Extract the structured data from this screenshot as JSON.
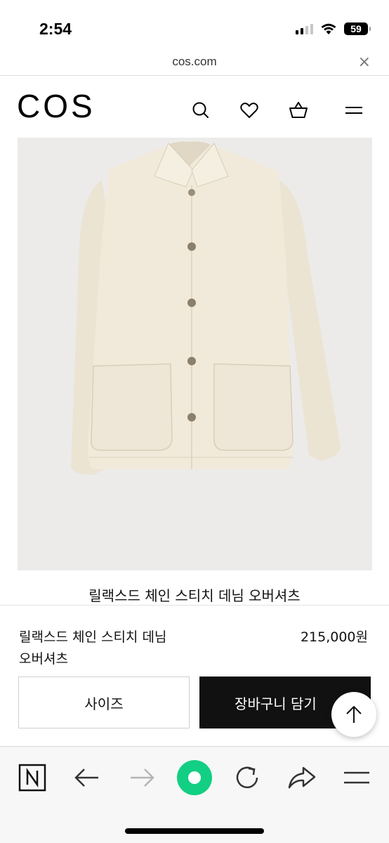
{
  "status_bar": {
    "time": "2:54",
    "battery": "59"
  },
  "browser": {
    "url": "cos.com",
    "close_glyph": "×"
  },
  "site": {
    "logo": "COS",
    "header_icons": [
      "search-icon",
      "heart-icon",
      "basket-icon",
      "menu-icon"
    ]
  },
  "product": {
    "image_alt_name": "product-image",
    "caption": "릴랙스드 체인 스티치 데님 오버셔츠",
    "name_line1": "릴랙스드 체인 스티치 데님",
    "name_line2": "오버셔츠",
    "price": "215,000원",
    "size_label": "사이즈",
    "cart_label": "장바구니 담기"
  },
  "toolbar": {
    "icons": [
      "naver-icon",
      "back-arrow-icon",
      "forward-arrow-icon",
      "green-dot-icon",
      "refresh-icon",
      "share-icon",
      "menu-icon"
    ]
  },
  "colors": {
    "accent_green": "#12cf83",
    "cart_bg": "#111111",
    "image_bg": "#ecebea"
  }
}
